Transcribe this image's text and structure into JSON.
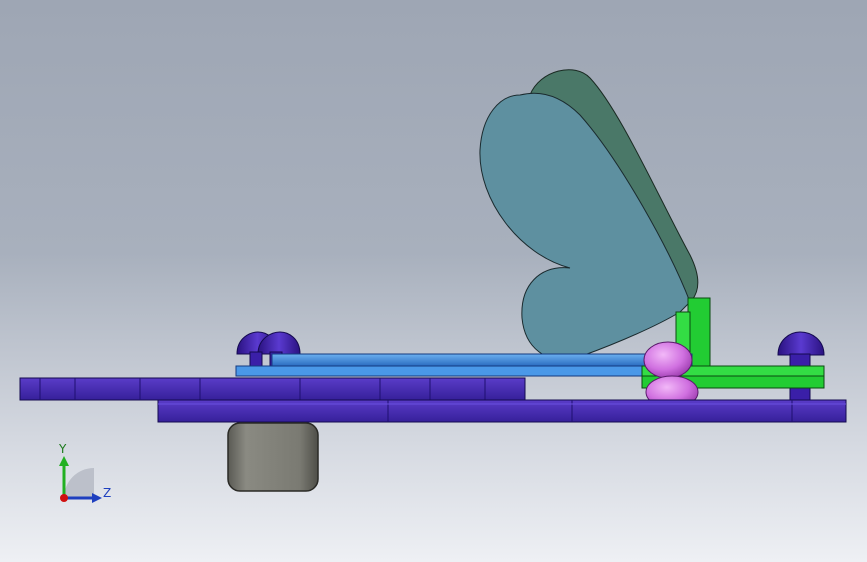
{
  "app": {
    "kind": "3D CAD model viewport"
  },
  "colors": {
    "background_top": "#9ea6b4",
    "background_bottom": "#eef0f4",
    "base_plate": "#4a2fb4",
    "base_plate_dark": "#2a1a80",
    "slide_rail": "#3d8ce0",
    "spring_clip": "#22cc33",
    "ball_bearing": "#d070e0",
    "cam_wing_front": "#5e90a0",
    "cam_wing_back": "#4a7868",
    "motor_housing": "#7a7a72",
    "bolt_head": "#3a1fa8"
  },
  "triad": {
    "y_label": "Y",
    "z_label": "Z",
    "x_color": "#d01010",
    "y_color": "#22b022",
    "z_color": "#1e3fbf"
  },
  "parts": [
    "base-plate",
    "lower-gear-plate",
    "slide-rail",
    "spring-bracket",
    "ball-bearing",
    "cam-wing-front",
    "cam-wing-back",
    "motor-block",
    "bolt-left",
    "bolt-right"
  ]
}
